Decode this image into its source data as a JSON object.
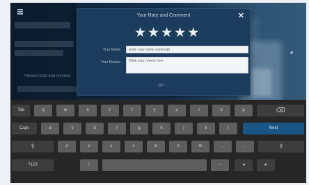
{
  "dialog": {
    "title": "Your Rate and Comment",
    "close_label": "✕",
    "rating": 5,
    "name_label": "Your Name",
    "name_value": "",
    "name_placeholder": "Enter your name (optional)",
    "comment_label": "Your Review",
    "comment_value": "",
    "comment_placeholder": "Write your review here",
    "ok_label": "OK"
  },
  "background": {
    "footer_text": "Please Rate and Review",
    "accent": "#1b3c5c"
  },
  "keyboard": {
    "row1": [
      "Tab",
      "q",
      "w",
      "e",
      "r",
      "t",
      "y",
      "u",
      "i",
      "o",
      "p",
      "⌫"
    ],
    "row2": [
      "Caps",
      "a",
      "s",
      "d",
      "f",
      "g",
      "h",
      "j",
      "k",
      "l",
      "Next"
    ],
    "row3": [
      "⇧",
      "z",
      "x",
      "c",
      "v",
      "b",
      "n",
      "m",
      ",",
      ".",
      "⇧"
    ],
    "row4": [
      "?123",
      "/",
      "",
      "-",
      "◂",
      "▸"
    ],
    "next_color": "#1a5685"
  }
}
